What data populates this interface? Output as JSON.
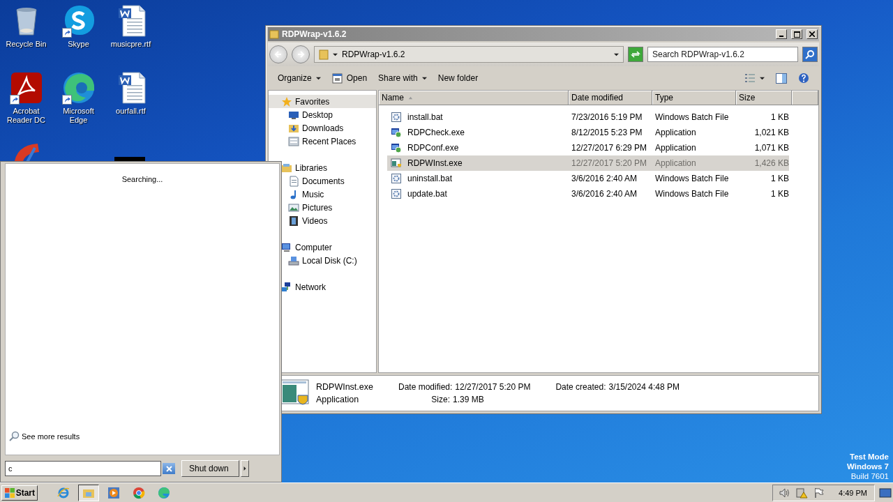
{
  "desktop_icons": [
    {
      "kind": "recycle",
      "label": "Recycle Bin",
      "shortcut": false
    },
    {
      "kind": "skype",
      "label": "Skype",
      "shortcut": true
    },
    {
      "kind": "word",
      "label": "musicpre.rtf",
      "shortcut": false
    },
    {
      "kind": "acrobat",
      "label": "Acrobat Reader DC",
      "shortcut": true
    },
    {
      "kind": "edge",
      "label": "Microsoft Edge",
      "shortcut": true
    },
    {
      "kind": "word",
      "label": "ourfall.rtf",
      "shortcut": false
    },
    {
      "kind": "cleaner"
    },
    {
      "kind": "blank"
    },
    {
      "kind": "dark"
    }
  ],
  "explorer": {
    "title": "RDPWrap-v1.6.2",
    "address": {
      "path": "RDPWrap-v1.6.2"
    },
    "search": {
      "placeholder": "Search RDPWrap-v1.6.2"
    },
    "toolbar": [
      {
        "label": "Organize",
        "kind": "menu"
      },
      {
        "label": "Open",
        "kind": "icon-button"
      },
      {
        "label": "Share with",
        "kind": "menu"
      },
      {
        "label": "New folder",
        "kind": "button"
      }
    ],
    "nav": [
      {
        "label": "Favorites",
        "kind": "star",
        "selected": true,
        "children": [
          {
            "label": "Desktop",
            "kind": "desktop",
            "selected": false
          },
          {
            "label": "Downloads",
            "kind": "downloads",
            "selected": false
          },
          {
            "label": "Recent Places",
            "kind": "recent",
            "selected": false
          }
        ]
      },
      {
        "label": "Libraries",
        "kind": "library",
        "selected": false,
        "children": [
          {
            "label": "Documents",
            "kind": "document",
            "selected": false
          },
          {
            "label": "Music",
            "kind": "music",
            "selected": false
          },
          {
            "label": "Pictures",
            "kind": "pictures",
            "selected": false
          },
          {
            "label": "Videos",
            "kind": "videos",
            "selected": false
          }
        ]
      },
      {
        "label": "Computer",
        "kind": "computer",
        "selected": false,
        "children": [
          {
            "label": "Local Disk (C:)",
            "kind": "disk",
            "selected": false
          }
        ]
      },
      {
        "label": "Network",
        "kind": "network",
        "selected": false
      }
    ],
    "columns": [
      {
        "label": "Name",
        "sorted": true
      },
      {
        "label": "Date modified",
        "sorted": false
      },
      {
        "label": "Type",
        "sorted": false
      },
      {
        "label": "Size",
        "sorted": false
      }
    ],
    "rows": [
      {
        "name": "install.bat",
        "date": "7/23/2016 5:19 PM",
        "type": "Windows Batch File",
        "size": "1 KB",
        "kind": "batch",
        "selected": false
      },
      {
        "name": "RDPCheck.exe",
        "date": "8/12/2015 5:23 PM",
        "type": "Application",
        "size": "1,021 KB",
        "kind": "program",
        "selected": false
      },
      {
        "name": "RDPConf.exe",
        "date": "12/27/2017 6:29 PM",
        "type": "Application",
        "size": "1,071 KB",
        "kind": "program",
        "selected": false
      },
      {
        "name": "RDPWInst.exe",
        "date": "12/27/2017 5:20 PM",
        "type": "Application",
        "size": "1,426 KB",
        "kind": "installer",
        "selected": true
      },
      {
        "name": "uninstall.bat",
        "date": "3/6/2016 2:40 AM",
        "type": "Windows Batch File",
        "size": "1 KB",
        "kind": "batch",
        "selected": false
      },
      {
        "name": "update.bat",
        "date": "3/6/2016 2:40 AM",
        "type": "Windows Batch File",
        "size": "1 KB",
        "kind": "batch",
        "selected": false
      }
    ],
    "details": {
      "name": "RDPWInst.exe",
      "type": "Application",
      "fields": [
        {
          "label": "Date modified:",
          "value": "12/27/2017 5:20 PM"
        },
        {
          "label": "Size:",
          "value": "1.39 MB"
        },
        {
          "label": "Date created:",
          "value": "3/15/2024 4:48 PM"
        }
      ]
    }
  },
  "start_menu": {
    "status": "Searching...",
    "more_results": "See more results",
    "search_value": "c",
    "shutdown": "Shut down"
  },
  "os_notice": [
    "Test Mode",
    "Windows 7",
    "Build 7601"
  ],
  "taskbar": {
    "start": "Start",
    "apps": [
      {
        "kind": "ie",
        "active": false
      },
      {
        "kind": "explorer",
        "active": true
      },
      {
        "kind": "media",
        "active": false
      },
      {
        "kind": "chrome",
        "active": false
      },
      {
        "kind": "edge",
        "active": false
      }
    ],
    "tray": [
      {
        "kind": "speaker"
      },
      {
        "kind": "network-warning"
      },
      {
        "kind": "flag"
      }
    ],
    "clock": "4:49 PM"
  }
}
